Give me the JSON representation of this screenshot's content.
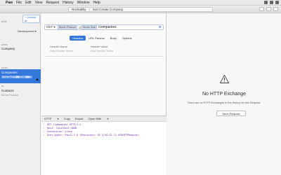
{
  "menubar": {
    "app": "Paw",
    "items": [
      "File",
      "Edit",
      "View",
      "Request",
      "History",
      "Window",
      "Help"
    ]
  },
  "titlebar": {
    "project": "Rockabilly",
    "request": "Sort Create Company"
  },
  "sidebar": {
    "default_btn": "+ Default ac",
    "label_requests": "ants",
    "label_groups": "uries",
    "environment": "Development",
    "item_company": "Company",
    "label_companies": "uries",
    "selected": {
      "title": "Companies",
      "badge1": "Server Protocol",
      "badge2": "Server Host",
      "badge3": "/com"
    },
    "label_contacts": "ts",
    "item_contacts": "Contacts",
    "contacts_sub": "Server Protocol"
  },
  "request": {
    "method": "GET",
    "token1": "Server Protocol",
    "token2": "Server Host",
    "path": "/companies",
    "tabs": [
      "Headers",
      "URL Params",
      "Body",
      "Options"
    ],
    "active_tab": "Headers",
    "col_name": "Header Name",
    "col_value": "Header Value",
    "ph_name": "Add Header Name",
    "ph_value": "Add Header Value"
  },
  "raw": {
    "toolbar": [
      "HTTP",
      "Copy",
      "Export",
      "Open With"
    ],
    "lines": [
      "GET /companies HTTP/1.1",
      "Host: localhost:3000",
      "Connection: close",
      "User-Agent: Paw/2.2.6 (Macintosh; OS X/10.11.2) GCDHTTPRequest"
    ]
  },
  "response": {
    "title": "No HTTP Exchange",
    "subtitle": "There are no HTTP Exchanges in the History for this Request.",
    "send_button": "Send Request"
  }
}
